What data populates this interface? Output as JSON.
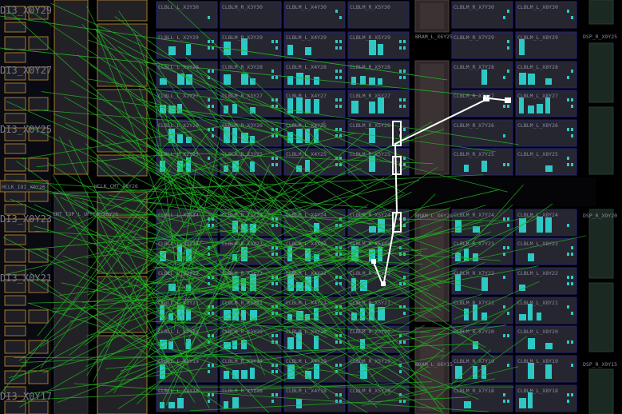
{
  "view": {
    "colors": {
      "background": "#000000",
      "tile_fill": "#262630",
      "tile_border": "#24247a",
      "io_border": "#a0782e",
      "cell_used": "#2ec8c4",
      "bram_fill": "#30282a",
      "route_green": "#22b422",
      "route_white": "#ffffff",
      "label": "#8a8aa0"
    },
    "io_labels": [
      {
        "id": "io-x0y29",
        "text": "DI3_X0Y29"
      },
      {
        "id": "io-x0y27",
        "text": "DI3_X0Y27"
      },
      {
        "id": "io-x0y25",
        "text": "DI3_X0Y25"
      },
      {
        "id": "io-x0y23",
        "text": "DI3_X0Y23"
      },
      {
        "id": "io-x0y21",
        "text": "DI3_X0Y21"
      },
      {
        "id": "io-x0y17",
        "text": "DI3_X0Y17"
      }
    ],
    "clock_labels": {
      "hclk_l": "HCLK_CMT_X8Y26",
      "io_small": "HCLK_IOI_X0Y26",
      "hclk_row2": "CMT_TOP_L_UPPER_X0Y26"
    },
    "columns": [
      {
        "id": "c1",
        "prefix": "CLBLL_L_X2",
        "usage": 0.55
      },
      {
        "id": "c2",
        "prefix": "CLBLM_R_X3",
        "usage": 0.75
      },
      {
        "id": "c3",
        "prefix": "CLBLM_L_X4",
        "usage": 0.7
      },
      {
        "id": "c4",
        "prefix": "CLBLM_R_X5",
        "usage": 0.5
      },
      {
        "id": "c5",
        "prefix": "CLBLM_R_X7",
        "usage": 0.4
      },
      {
        "id": "c6",
        "prefix": "CLBLM_L_X8",
        "usage": 0.5
      }
    ],
    "rows": [
      "Y30",
      "Y29",
      "Y28",
      "Y27",
      "Y26",
      "Y25",
      "Y24",
      "Y23",
      "Y22",
      "Y21",
      "Y20",
      "Y19",
      "Y18"
    ],
    "bram_labels": {
      "top": "BRAM_L_X6Y25",
      "mid": "BRAM_L_X6Y20",
      "bot": "BRAM_L_X6Y15"
    },
    "dsp_labels": {
      "top": "DSP_R_X9Y25",
      "mid": "DSP_R_X9Y20",
      "bot": "DSP_R_X9Y15"
    }
  }
}
